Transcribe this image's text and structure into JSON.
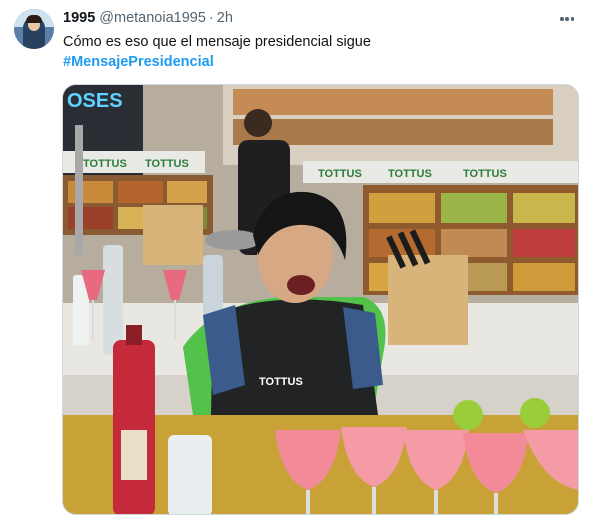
{
  "tweet": {
    "author_name": "1995",
    "author_handle": "@metanoia1995",
    "separator": "·",
    "timestamp": "2h",
    "text": "Cómo es eso que el mensaje presidencial sigue",
    "hashtag": "#MensajePresidencial",
    "more_icon": "more-horizontal-icon"
  },
  "media": {
    "store_banner": [
      "TOTTUS",
      "TOTTUS",
      "TOTTUS",
      "TOTTUS",
      "TOTTUS"
    ],
    "apron_logo": "TOTTUS",
    "neon_sign": "OSES",
    "colors": {
      "link": "#1d9bf0",
      "shelf_wood": "#c9773a",
      "banner_green": "#2d7d3a",
      "shirt_green": "#52c24a",
      "drink_red": "#e8284a"
    }
  }
}
